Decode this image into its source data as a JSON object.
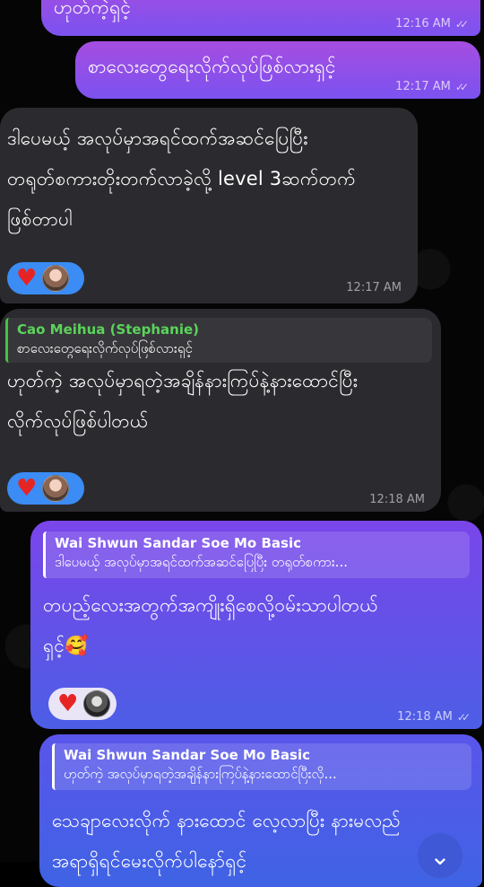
{
  "messages": [
    {
      "id": "m1",
      "text": "ဟုတ်ကဲ့ရှင့်",
      "time": "12:16 AM",
      "status": "read"
    },
    {
      "id": "m2",
      "text": "စာလေးတွေရေးလိုက်လုပ်ဖြစ်လားရှင့်",
      "time": "12:17 AM",
      "status": "read"
    },
    {
      "id": "m3",
      "text": "ဒါပေမယ့် အလုပ်မှာအရင်ထက်အဆင်ပြေပြီး\nတရုတ်စကားတိုးတက်လာခဲ့လို့ level 3ဆက်တက်\nဖြစ်တာပါ",
      "time": "12:17 AM"
    },
    {
      "id": "m4",
      "quote_name": "Cao Meihua (Stephanie)",
      "quote_text": "စာလေးတွေရေးလိုက်လုပ်ဖြစ်လားရှင့်",
      "text": "ဟုတ်ကဲ့ အလုပ်မှာရတဲ့အချိန်နားကြပ်နဲ့နားထောင်ပြီး\nလိုက်လုပ်ဖြစ်ပါတယ်",
      "time": "12:18 AM"
    },
    {
      "id": "m5",
      "quote_name": "Wai Shwun Sandar Soe Mo Basic",
      "quote_text": "ဒါပေမယ့် အလုပ်မှာအရင်ထက်အဆင်ပြေပြီး တရုတ်စကား...",
      "text": "တပည့်လေးအတွက်အကျိုးရှိစေလို့ဝမ်းသာပါတယ်\nရှင့်🥰",
      "time": "12:18 AM",
      "status": "read"
    },
    {
      "id": "m6",
      "quote_name": "Wai Shwun Sandar Soe Mo Basic",
      "quote_text": "ဟုတ်ကဲ့ အလုပ်မှာရတဲ့အချိန်နားကြပ်နဲ့နားထောင်ပြီးလို...",
      "text": "သေချာလေးလိုက် နားထောင် လေ့လာပြီး နားမလည်\nအရာရှိရင်မေးလိုက်ပါနော်ရှင့်"
    }
  ],
  "reactions": {
    "emoji": "heart",
    "color": "#e62424"
  },
  "icons": {
    "check": "double-check-icon",
    "scroll": "chevron-down-icon"
  },
  "colors": {
    "outgoing_top": "#a64de0",
    "outgoing_bottom": "#4d5ee6",
    "incoming": "#2b2b2f",
    "reaction_bg": "#3b8cf4",
    "quote_green": "#5bd45a"
  }
}
